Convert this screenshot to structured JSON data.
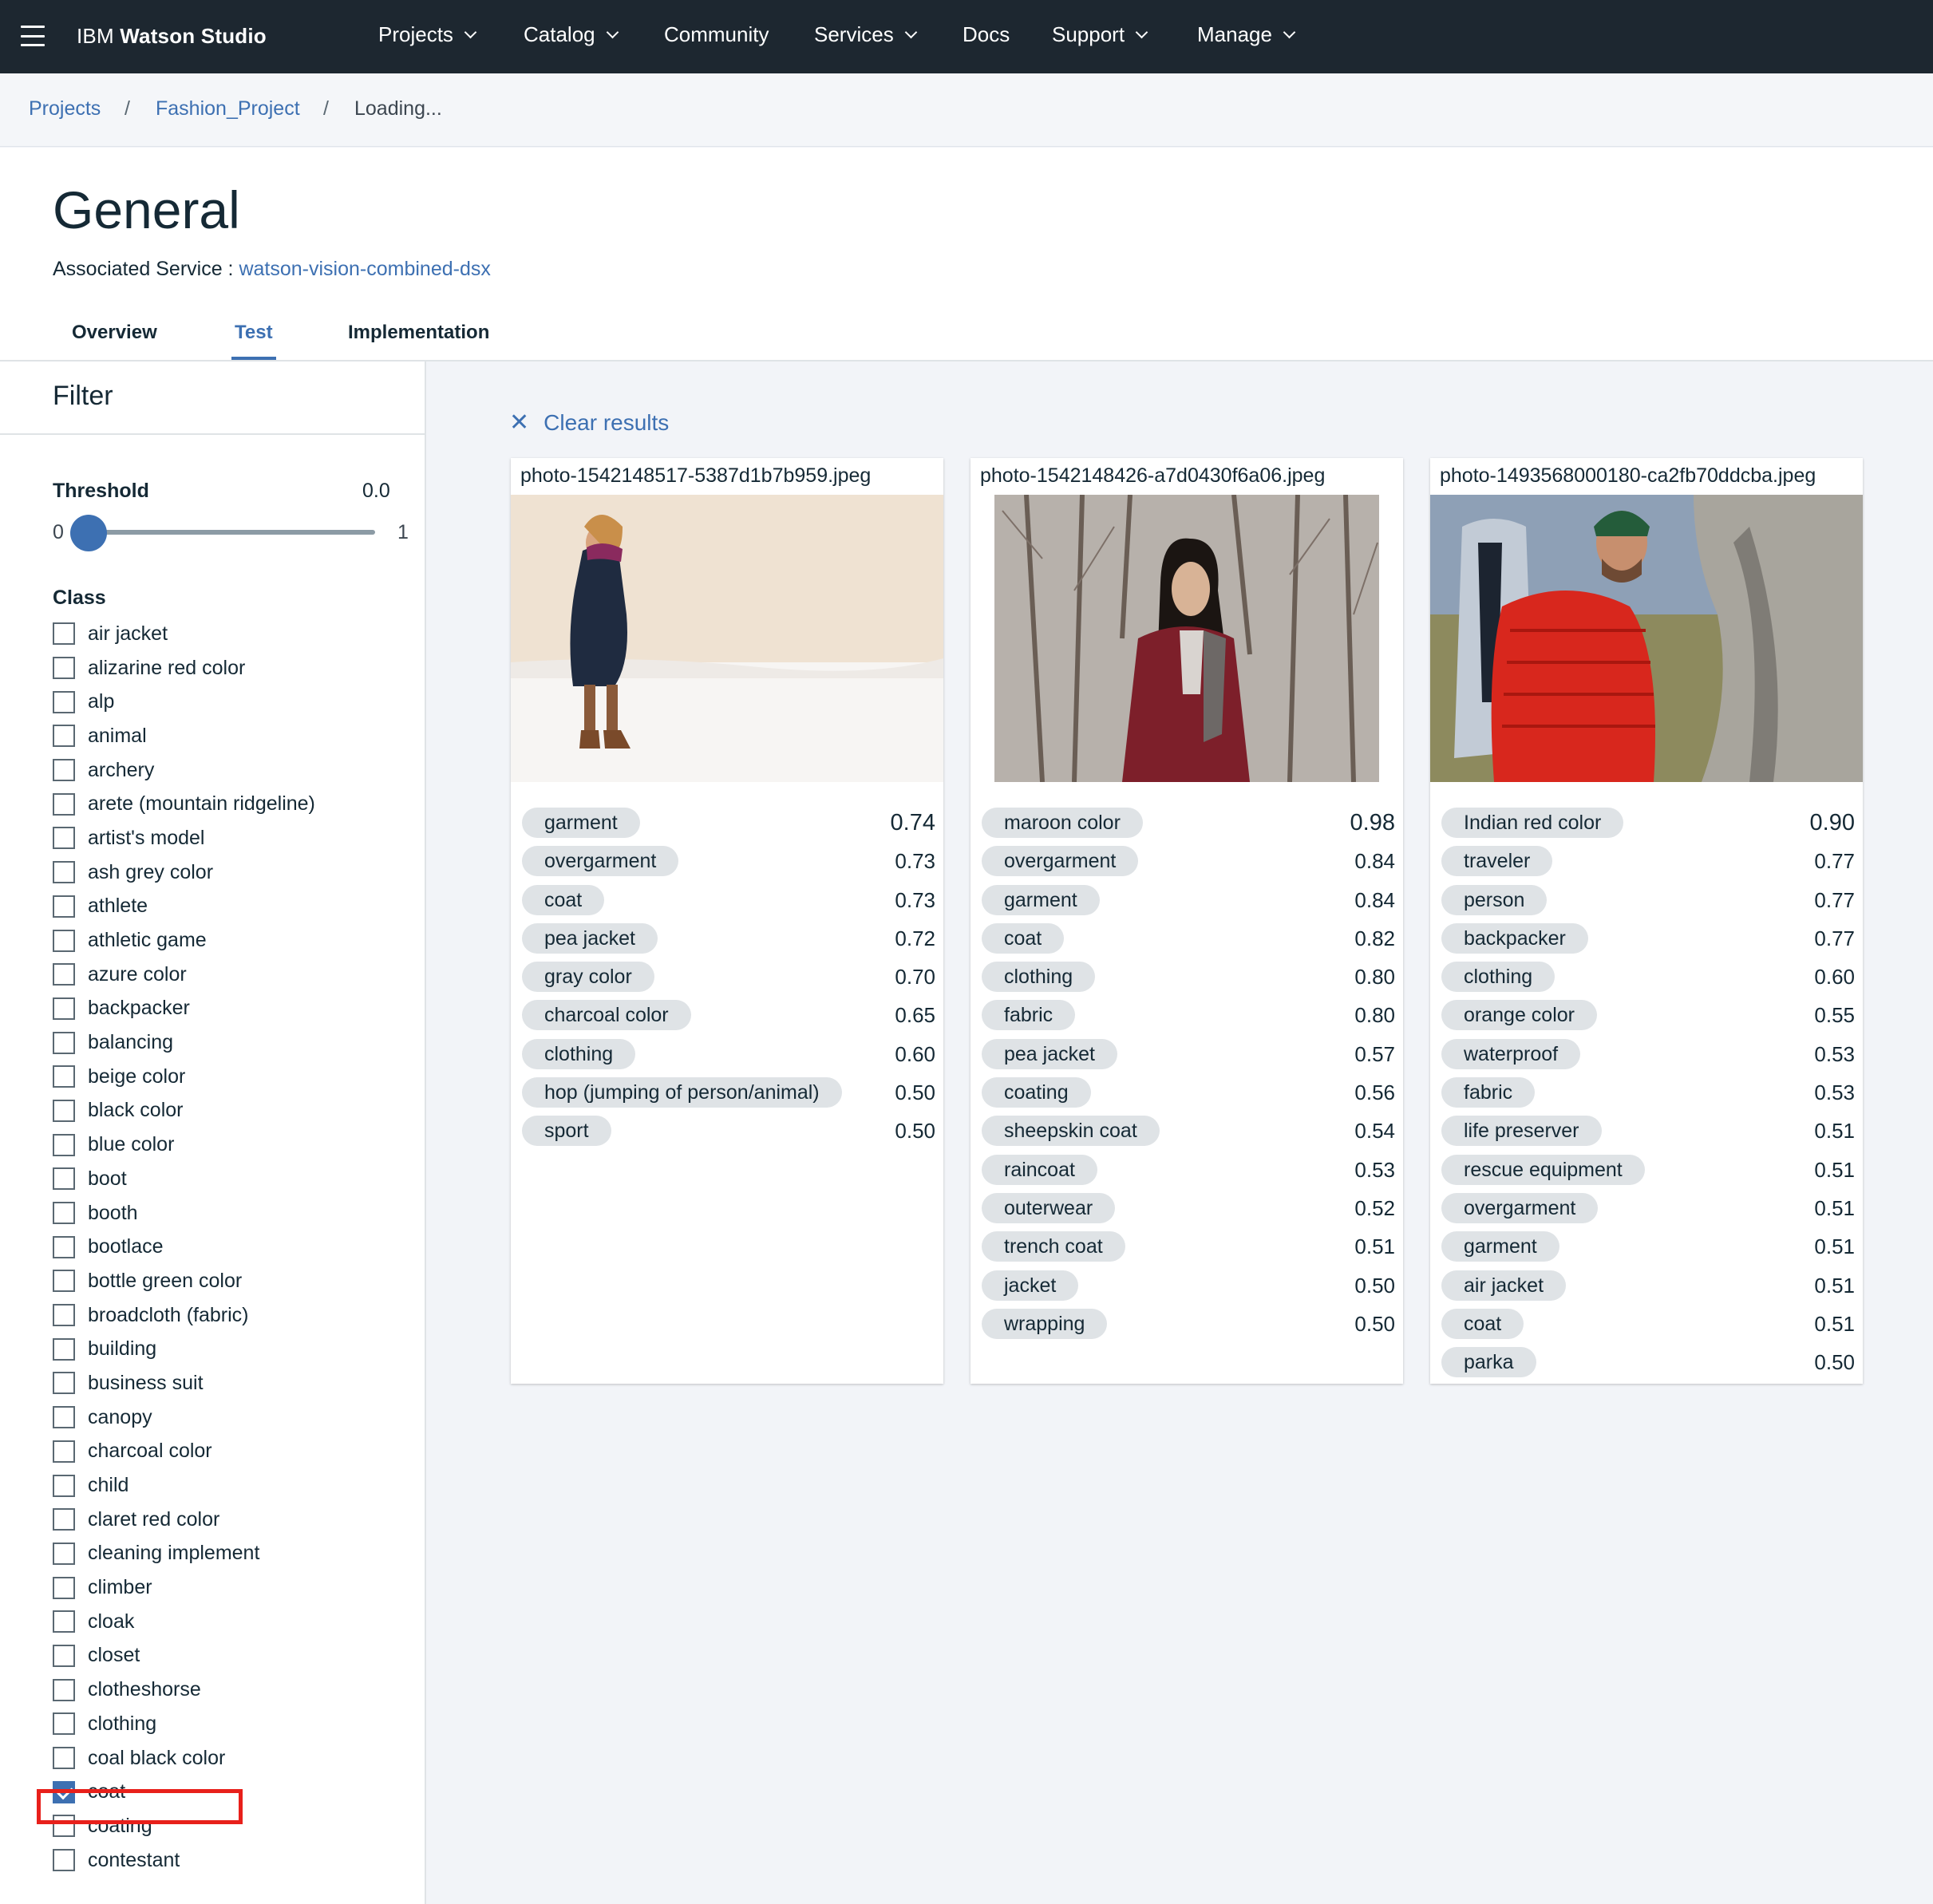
{
  "nav": {
    "brand_pre": "IBM",
    "brand_bold": "Watson Studio",
    "items": [
      {
        "label": "Projects",
        "dropdown": true
      },
      {
        "label": "Catalog",
        "dropdown": true
      },
      {
        "label": "Community",
        "dropdown": false
      },
      {
        "label": "Services",
        "dropdown": true
      },
      {
        "label": "Docs",
        "dropdown": false
      },
      {
        "label": "Support",
        "dropdown": true
      },
      {
        "label": "Manage",
        "dropdown": true
      }
    ]
  },
  "breadcrumb": {
    "items": [
      "Projects",
      "Fashion_Project",
      "Loading..."
    ],
    "separator": "/"
  },
  "page": {
    "title": "General",
    "assoc_label": "Associated Service :",
    "assoc_link": "watson-vision-combined-dsx",
    "tabs": [
      "Overview",
      "Test",
      "Implementation"
    ],
    "active_tab": "Test"
  },
  "filter": {
    "title": "Filter",
    "threshold_label": "Threshold",
    "threshold_value": "0.0",
    "slider_min": "0",
    "slider_max": "1",
    "slider_level": 0.0,
    "class_label": "Class",
    "classes": [
      {
        "label": "air jacket",
        "checked": false
      },
      {
        "label": "alizarine red color",
        "checked": false
      },
      {
        "label": "alp",
        "checked": false
      },
      {
        "label": "animal",
        "checked": false
      },
      {
        "label": "archery",
        "checked": false
      },
      {
        "label": "arete (mountain ridgeline)",
        "checked": false
      },
      {
        "label": "artist's model",
        "checked": false
      },
      {
        "label": "ash grey color",
        "checked": false
      },
      {
        "label": "athlete",
        "checked": false
      },
      {
        "label": "athletic game",
        "checked": false
      },
      {
        "label": "azure color",
        "checked": false
      },
      {
        "label": "backpacker",
        "checked": false
      },
      {
        "label": "balancing",
        "checked": false
      },
      {
        "label": "beige color",
        "checked": false
      },
      {
        "label": "black color",
        "checked": false
      },
      {
        "label": "blue color",
        "checked": false
      },
      {
        "label": "boot",
        "checked": false
      },
      {
        "label": "booth",
        "checked": false
      },
      {
        "label": "bootlace",
        "checked": false
      },
      {
        "label": "bottle green color",
        "checked": false
      },
      {
        "label": "broadcloth (fabric)",
        "checked": false
      },
      {
        "label": "building",
        "checked": false
      },
      {
        "label": "business suit",
        "checked": false
      },
      {
        "label": "canopy",
        "checked": false
      },
      {
        "label": "charcoal color",
        "checked": false
      },
      {
        "label": "child",
        "checked": false
      },
      {
        "label": "claret red color",
        "checked": false
      },
      {
        "label": "cleaning implement",
        "checked": false
      },
      {
        "label": "climber",
        "checked": false
      },
      {
        "label": "cloak",
        "checked": false
      },
      {
        "label": "closet",
        "checked": false
      },
      {
        "label": "clotheshorse",
        "checked": false
      },
      {
        "label": "clothing",
        "checked": false
      },
      {
        "label": "coal black color",
        "checked": false
      },
      {
        "label": "coat",
        "checked": true
      },
      {
        "label": "coating",
        "checked": false
      },
      {
        "label": "contestant",
        "checked": false
      }
    ]
  },
  "results": {
    "clear_label": "Clear results",
    "cards": [
      {
        "filename": "photo-1542148517-5387d1b7b959.jpeg",
        "tags": [
          {
            "label": "garment",
            "score": "0.74"
          },
          {
            "label": "overgarment",
            "score": "0.73"
          },
          {
            "label": "coat",
            "score": "0.73"
          },
          {
            "label": "pea jacket",
            "score": "0.72"
          },
          {
            "label": "gray color",
            "score": "0.70"
          },
          {
            "label": "charcoal color",
            "score": "0.65"
          },
          {
            "label": "clothing",
            "score": "0.60"
          },
          {
            "label": "hop (jumping of person/animal)",
            "score": "0.50"
          },
          {
            "label": "sport",
            "score": "0.50"
          }
        ]
      },
      {
        "filename": "photo-1542148426-a7d0430f6a06.jpeg",
        "tags": [
          {
            "label": "maroon color",
            "score": "0.98"
          },
          {
            "label": "overgarment",
            "score": "0.84"
          },
          {
            "label": "garment",
            "score": "0.84"
          },
          {
            "label": "coat",
            "score": "0.82"
          },
          {
            "label": "clothing",
            "score": "0.80"
          },
          {
            "label": "fabric",
            "score": "0.80"
          },
          {
            "label": "pea jacket",
            "score": "0.57"
          },
          {
            "label": "coating",
            "score": "0.56"
          },
          {
            "label": "sheepskin coat",
            "score": "0.54"
          },
          {
            "label": "raincoat",
            "score": "0.53"
          },
          {
            "label": "outerwear",
            "score": "0.52"
          },
          {
            "label": "trench coat",
            "score": "0.51"
          },
          {
            "label": "jacket",
            "score": "0.50"
          },
          {
            "label": "wrapping",
            "score": "0.50"
          }
        ]
      },
      {
        "filename": "photo-1493568000180-ca2fb70ddcba.jpeg",
        "tags": [
          {
            "label": "Indian red color",
            "score": "0.90"
          },
          {
            "label": "traveler",
            "score": "0.77"
          },
          {
            "label": "person",
            "score": "0.77"
          },
          {
            "label": "backpacker",
            "score": "0.77"
          },
          {
            "label": "clothing",
            "score": "0.60"
          },
          {
            "label": "orange color",
            "score": "0.55"
          },
          {
            "label": "waterproof",
            "score": "0.53"
          },
          {
            "label": "fabric",
            "score": "0.53"
          },
          {
            "label": "life preserver",
            "score": "0.51"
          },
          {
            "label": "rescue equipment",
            "score": "0.51"
          },
          {
            "label": "overgarment",
            "score": "0.51"
          },
          {
            "label": "garment",
            "score": "0.51"
          },
          {
            "label": "air jacket",
            "score": "0.51"
          },
          {
            "label": "coat",
            "score": "0.51"
          },
          {
            "label": "parka",
            "score": "0.50"
          }
        ]
      }
    ]
  }
}
